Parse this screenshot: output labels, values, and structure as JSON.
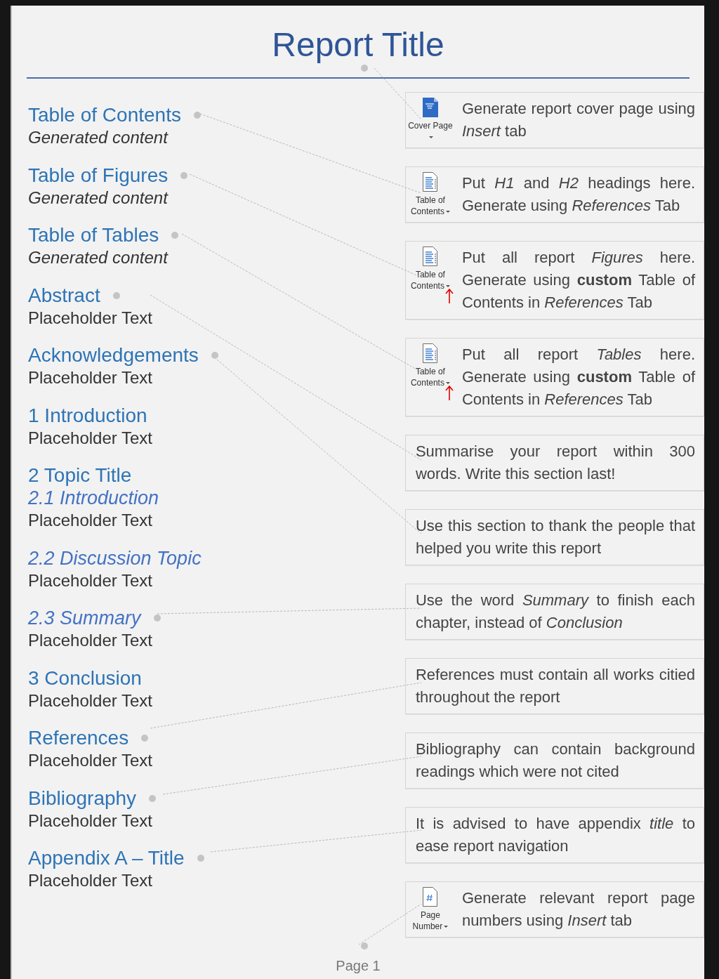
{
  "title": {
    "text": "Report Title",
    "leader": true
  },
  "sections": [
    {
      "kind": "h1",
      "heading": "Table of Contents",
      "body": {
        "text": "Generated content",
        "kind": "generated"
      },
      "leader": true
    },
    {
      "kind": "h1",
      "heading": "Table of Figures",
      "body": {
        "text": "Generated content",
        "kind": "generated"
      },
      "leader": true
    },
    {
      "kind": "h1",
      "heading": "Table of Tables",
      "body": {
        "text": "Generated content",
        "kind": "generated"
      },
      "leader": true
    },
    {
      "kind": "h1",
      "heading": "Abstract",
      "body": {
        "text": "Placeholder Text",
        "kind": "placeholder"
      },
      "leader": true
    },
    {
      "kind": "h1",
      "heading": "Acknowledgements",
      "body": {
        "text": "Placeholder Text",
        "kind": "placeholder"
      },
      "leader": true
    },
    {
      "kind": "h1",
      "heading": "1 Introduction",
      "body": {
        "text": "Placeholder Text",
        "kind": "placeholder"
      },
      "leader": false
    },
    {
      "kind": "h1",
      "heading": "2 Topic Title",
      "leader": false
    },
    {
      "kind": "h2",
      "heading": "2.1 Introduction",
      "body": {
        "text": "Placeholder Text",
        "kind": "placeholder"
      },
      "leader": false
    },
    {
      "kind": "h2",
      "heading": "2.2 Discussion Topic",
      "body": {
        "text": "Placeholder Text",
        "kind": "placeholder"
      },
      "leader": false
    },
    {
      "kind": "h2",
      "heading": "2.3 Summary",
      "body": {
        "text": "Placeholder Text",
        "kind": "placeholder"
      },
      "leader": true
    },
    {
      "kind": "h1",
      "heading": "3 Conclusion",
      "body": {
        "text": "Placeholder Text",
        "kind": "placeholder"
      },
      "leader": false
    },
    {
      "kind": "h1",
      "heading": "References",
      "body": {
        "text": "Placeholder Text",
        "kind": "placeholder"
      },
      "leader": true
    },
    {
      "kind": "h1",
      "heading": "Bibliography",
      "body": {
        "text": "Placeholder Text",
        "kind": "placeholder"
      },
      "leader": true
    },
    {
      "kind": "h1",
      "heading": "Appendix A – Title",
      "body": {
        "text": "Placeholder Text",
        "kind": "placeholder"
      },
      "leader": true
    }
  ],
  "callouts": [
    {
      "kind": "cover",
      "button_label": "Cover Page",
      "arrow": false,
      "text": "Generate report cover page using *Insert* tab"
    },
    {
      "kind": "toc",
      "button_label": "Table of Contents",
      "arrow": false,
      "text": "Put *H1* and *H2* headings here. Generate using *References* Tab"
    },
    {
      "kind": "toc",
      "button_label": "Table of Contents",
      "arrow": true,
      "text": "Put all report *Figures* here. Generate using **custom** Table of Contents in *References* Tab"
    },
    {
      "kind": "toc",
      "button_label": "Table of Contents",
      "arrow": true,
      "text": "Put all report *Tables* here. Generate using **custom** Table of Contents in *References* Tab"
    },
    {
      "kind": "plain",
      "text": "Summarise your report within 300 words. Write this section last!"
    },
    {
      "kind": "plain",
      "text": "Use this section to thank the people that helped you write this report"
    },
    {
      "kind": "plain",
      "text": "Use the word *Summary* to finish each chapter, instead of *Conclusion*"
    },
    {
      "kind": "plain",
      "text": "References must contain all works citied throughout the report"
    },
    {
      "kind": "plain",
      "text": "Bibliography can contain background readings which were not cited"
    },
    {
      "kind": "plain",
      "text": "It is advised to have appendix *title* to ease report navigation"
    },
    {
      "kind": "page-number",
      "button_label": "Page Number",
      "arrow": false,
      "text": "Generate relevant report page numbers using *Insert* tab"
    }
  ],
  "footer": {
    "text": "Page 1",
    "leader": true
  }
}
